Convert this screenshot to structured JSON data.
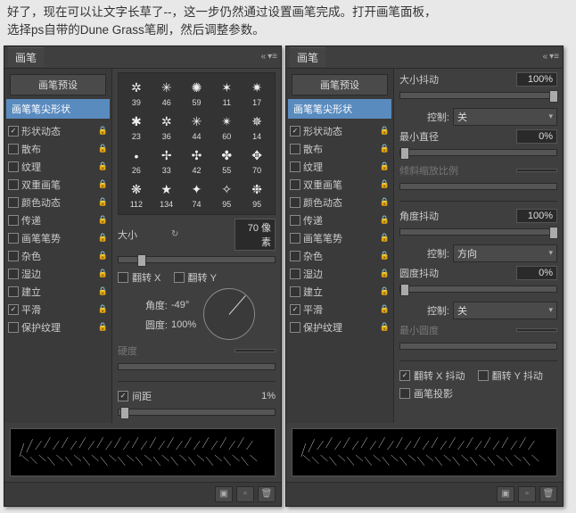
{
  "instruction": {
    "line1": "好了，现在可以让文字长草了--，这一步仍然通过设置画笔完成。打开画笔面板，",
    "line2": "选择ps自带的Dune Grass笔刷，然后调整参数。"
  },
  "panel": {
    "title": "画笔",
    "preset_button": "画笔预设",
    "tip_shape_tab": "画笔笔尖形状"
  },
  "sidebar": {
    "items": [
      {
        "label": "形状动态",
        "checked": true,
        "lock": true
      },
      {
        "label": "散布",
        "checked": false,
        "lock": true
      },
      {
        "label": "纹理",
        "checked": false,
        "lock": true
      },
      {
        "label": "双重画笔",
        "checked": false,
        "lock": true
      },
      {
        "label": "颜色动态",
        "checked": false,
        "lock": true
      },
      {
        "label": "传递",
        "checked": false,
        "lock": true
      },
      {
        "label": "画笔笔势",
        "checked": false,
        "lock": true
      },
      {
        "label": "杂色",
        "checked": false,
        "lock": true
      },
      {
        "label": "湿边",
        "checked": false,
        "lock": true
      },
      {
        "label": "建立",
        "checked": false,
        "lock": true
      },
      {
        "label": "平滑",
        "checked": true,
        "lock": true
      },
      {
        "label": "保护纹理",
        "checked": false,
        "lock": true
      }
    ]
  },
  "brushes": [
    {
      "size": "39",
      "glyph": "✲"
    },
    {
      "size": "46",
      "glyph": "✳"
    },
    {
      "size": "59",
      "glyph": "✺"
    },
    {
      "size": "11",
      "glyph": "✶"
    },
    {
      "size": "17",
      "glyph": "✷"
    },
    {
      "size": "23",
      "glyph": "✱"
    },
    {
      "size": "36",
      "glyph": "✲"
    },
    {
      "size": "44",
      "glyph": "✳"
    },
    {
      "size": "60",
      "glyph": "✴"
    },
    {
      "size": "14",
      "glyph": "✵"
    },
    {
      "size": "26",
      "glyph": "•"
    },
    {
      "size": "33",
      "glyph": "✢"
    },
    {
      "size": "42",
      "glyph": "✣"
    },
    {
      "size": "55",
      "glyph": "✤"
    },
    {
      "size": "70",
      "glyph": "✥"
    },
    {
      "size": "112",
      "glyph": "❋"
    },
    {
      "size": "134",
      "glyph": "★"
    },
    {
      "size": "74",
      "glyph": "✦"
    },
    {
      "size": "95",
      "glyph": "✧"
    },
    {
      "size": "95",
      "glyph": "❉"
    }
  ],
  "left": {
    "size_label": "大小",
    "size_value": "70 像素",
    "flip_x": "翻转 X",
    "flip_y": "翻转 Y",
    "angle_label": "角度:",
    "angle_value": "-49°",
    "roundness_label": "圆度:",
    "roundness_value": "100%",
    "hardness_label": "硬度",
    "spacing_label": "间距",
    "spacing_value": "1%"
  },
  "right": {
    "size_jitter_label": "大小抖动",
    "size_jitter_value": "100%",
    "control_label": "控制:",
    "control_off": "关",
    "min_diameter_label": "最小直径",
    "min_diameter_value": "0%",
    "tilt_scale_label": "倾斜缩放比例",
    "angle_jitter_label": "角度抖动",
    "angle_jitter_value": "100%",
    "control_direction": "方向",
    "roundness_jitter_label": "圆度抖动",
    "roundness_jitter_value": "0%",
    "min_roundness_label": "最小圆度",
    "flip_x_jitter": "翻转 X 抖动",
    "flip_y_jitter": "翻转 Y 抖动",
    "brush_projection": "画笔投影"
  }
}
